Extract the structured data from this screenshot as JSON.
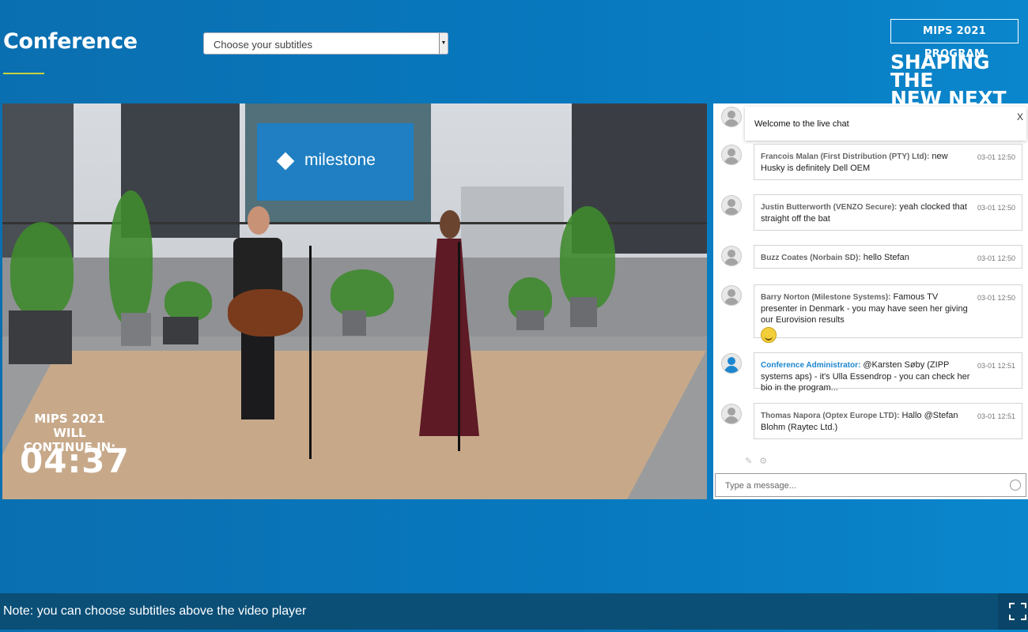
{
  "header": {
    "title": "Conference",
    "subtitle_select": {
      "selected": "Choose your subtitles"
    },
    "program_button": "MIPS 2021 PROGRAM",
    "slogan_line1": "SHAPING THE",
    "slogan_line2": "NEW NEXT"
  },
  "video": {
    "screen_brand": "milestone",
    "countdown_label_line1": "MIPS 2021 WILL",
    "countdown_label_line2": "CONTINUE IN:",
    "countdown_time": "04:37"
  },
  "chat": {
    "welcome": "Welcome to the live chat",
    "close_label": "X",
    "messages": [
      {
        "author": "Francois Malan (First Distribution (PTY) Ltd):",
        "text": "new Husky is definitely Dell OEM",
        "time": "03-01 12:50"
      },
      {
        "author": "Justin Butterworth (VENZO Secure):",
        "text": "yeah clocked that straight off the bat",
        "time": "03-01 12:50"
      },
      {
        "author": "Buzz Coates (Norbain SD):",
        "text": "hello Stefan",
        "time": "03-01 12:50"
      },
      {
        "author": "Barry Norton (Milestone Systems):",
        "text": "Famous TV presenter in Denmark - you may have seen her giving our Eurovision results",
        "time": "03-01 12:50"
      },
      {
        "author": "Conference Administrator:",
        "text": "@Karsten Søby (ZIPP systems aps) - it's Ulla Essendrop - you can check her bio in the program...",
        "time": "03-01 12:51"
      },
      {
        "author": "Thomas Napora (Optex Europe LTD):",
        "text": "Hallo @Stefan Blohm (Raytec Ltd.)",
        "time": "03-01 12:51"
      }
    ],
    "input_placeholder": "Type a message..."
  },
  "footer": {
    "note": "Note: you can choose subtitles above the video player"
  },
  "colors": {
    "background": "#0878be",
    "accent_underline": "#c8d33a",
    "note_bar": "#0b4f77",
    "admin_blue": "#1c86cf"
  },
  "icons": [
    "avatar-icon",
    "admin-avatar-icon",
    "smiley-icon",
    "pin-icon",
    "settings-icon",
    "emoji-icon",
    "fullscreen-icon",
    "dropdown-arrow-icon"
  ]
}
